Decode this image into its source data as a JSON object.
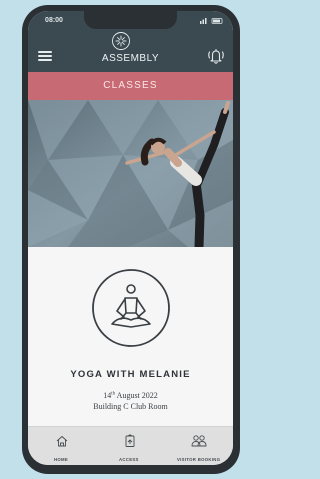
{
  "status_bar": {
    "time": "08:00"
  },
  "header": {
    "brand": "ASSEMBLY",
    "logo_icon": "assembly-logo-icon",
    "menu_icon": "hamburger-menu-icon",
    "notification_icon": "bell-icon"
  },
  "section": {
    "title": "CLASSES"
  },
  "class": {
    "title": "YOGA WITH MELANIE",
    "date_day": "14",
    "date_suffix": "th",
    "date_rest": " August 2022",
    "location": "Building C Club Room",
    "icon": "meditation-icon"
  },
  "tabs": [
    {
      "label": "HOME",
      "icon": "home-icon"
    },
    {
      "label": "ACCESS",
      "icon": "access-icon"
    },
    {
      "label": "VISITOR BOOKING",
      "icon": "visitors-icon"
    }
  ],
  "colors": {
    "header": "#3b4a50",
    "accent": "#c86a73",
    "background": "#c2e0ea"
  }
}
